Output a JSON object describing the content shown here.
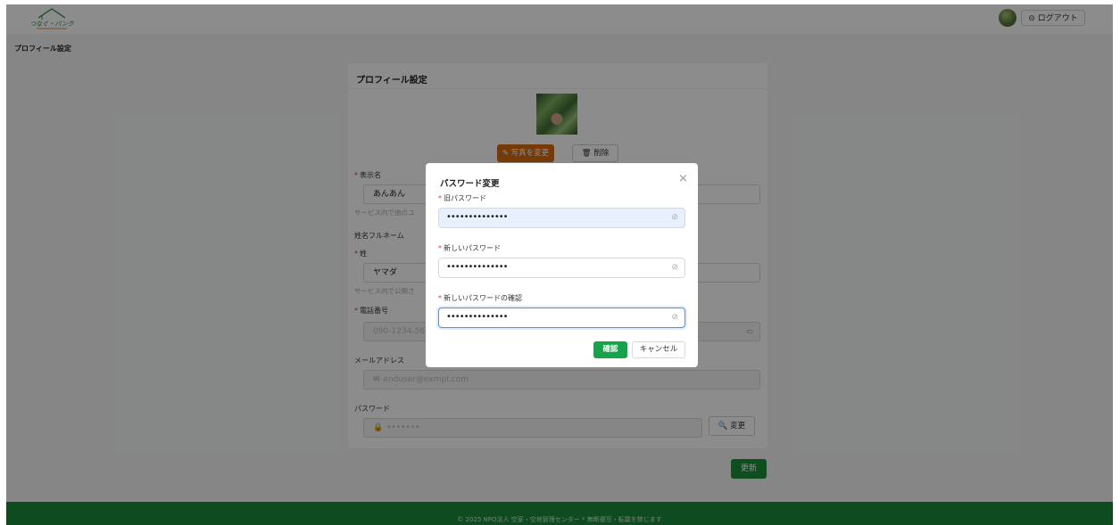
{
  "header": {
    "logo_icon": "house-logo-icon",
    "logo_text": "つなぐ・パンク",
    "logout_icon": "logout-icon",
    "logout_label": "ログアウト"
  },
  "breadcrumb": "プロフィール設定",
  "profile_card": {
    "title": "プロフィール設定",
    "change_photo_label": "写真を変更",
    "delete_photo_label": "削除",
    "display_name": {
      "label": "表示名",
      "value": "あんあん",
      "help": "サービス内で他のユ"
    },
    "fullname_section": "姓名フルネーム",
    "last_name": {
      "label": "姓",
      "value": "ヤマダ",
      "help": "サービス内で公開さ"
    },
    "phone": {
      "label": "電話番号",
      "placeholder": "090-1234-5670"
    },
    "email": {
      "label": "メールアドレス",
      "value": "enduser@exmpl.com"
    },
    "password": {
      "label": "パスワード",
      "value": "•••••••",
      "change_label": "変更"
    },
    "update_label": "更新"
  },
  "footer": "© 2025 NPO法人 空家・空地管理センター * 無断複写・転載を禁じます",
  "modal": {
    "title": "パスワード変更",
    "old_password_label": "旧パスワード",
    "old_password_value": "••••••••••••••",
    "new_password_label": "新しいパスワード",
    "new_password_value": "••••••••••••••",
    "confirm_password_label": "新しいパスワードの確認",
    "confirm_password_value": "••••••••••••••",
    "confirm_label": "確認",
    "cancel_label": "キャンセル",
    "close_icon": "×"
  },
  "colors": {
    "brand_green": "#1b8a3b",
    "accent_orange": "#d66a0f",
    "confirm_green": "#16a34a",
    "focus_blue": "#4096ff"
  }
}
